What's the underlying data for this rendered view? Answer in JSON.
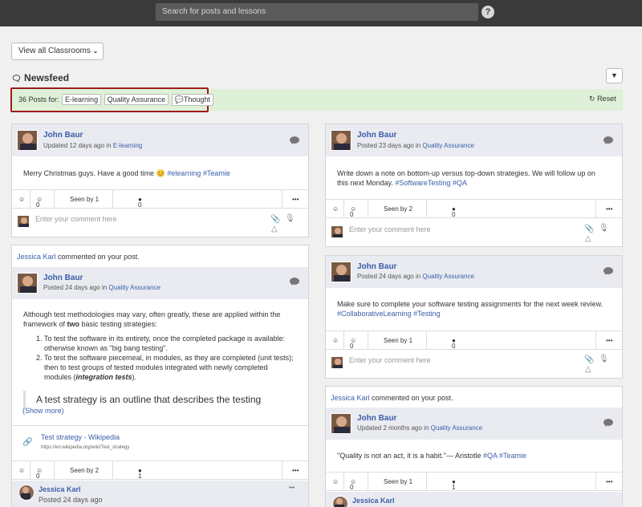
{
  "topbar": {
    "search_placeholder": "Search for posts and lessons",
    "help": "?"
  },
  "view_all": "View all Classrooms",
  "newsfeed_title": "Newsfeed",
  "filter": {
    "count_text": "36 Posts for:",
    "tags": [
      "E-learning",
      "Quality Assurance",
      "Thought"
    ],
    "reset": "Reset"
  },
  "common": {
    "comment_placeholder": "Enter your comment here",
    "likes": "0",
    "more": "•••",
    "commented_suffix": "commented on your post.",
    "in": "in"
  },
  "posts": [
    {
      "author": "John Baur",
      "time": "Updated 12 days ago",
      "category": "E-learning",
      "text": "Merry Christmas guys. Have a good time 😊 ",
      "hashtags": [
        "#elearning",
        "#Teamie"
      ],
      "seen": "Seen by 1",
      "comments": "0"
    },
    {
      "commenter": "Jessica Karl",
      "author": "John Baur",
      "time": "Posted 24 days ago",
      "category": "Quality Assurance",
      "intro_a": "Although test methodologies may vary, often greatly, these are applied within the",
      "intro_b": "framework of ",
      "intro_bold": "two",
      "intro_c": " basic testing strategies:",
      "li1_a": "To test the software in its entirety, once the completed package is available:",
      "li1_b": "otherwise known as \"big bang testing\".",
      "li2_a": "To test the ",
      "li2_link": "software piecemeal",
      "li2_b": ", in modules, as they are completed (unit tests);",
      "li2_c": "then to test groups of tested modules integrated with newly completed",
      "li2_d": "modules (",
      "li2_em": "integration tests",
      "li2_e": ").",
      "quote": "A test strategy is an outline that describes the testing",
      "show_more": "(Show more)",
      "link_title": "Test strategy - Wikipedia",
      "link_url": "https://en.wikipedia.org/wiki/Test_strategy",
      "seen": "Seen by 2",
      "comments": "1",
      "reply_author": "Jessica Karl",
      "reply_time": "Posted 24 days ago"
    },
    {
      "author": "John Baur",
      "time": "Posted 23 days ago",
      "category": "Quality Assurance",
      "text_a": "Write down a note on bottom-up versus top-down strategies. We will follow up on",
      "text_b": "this next Monday. ",
      "hashtags": [
        "#SoftwareTesting",
        "#QA"
      ],
      "seen": "Seen by 2",
      "comments": "0"
    },
    {
      "author": "John Baur",
      "time": "Posted 24 days ago",
      "category": "Quality Assurance",
      "text_a": "Make sure to complete your software testing assignments for the next week review.",
      "hashtags": [
        "#CollaborativeLearning",
        "#Testing"
      ],
      "seen": "Seen by 1",
      "comments": "0"
    },
    {
      "commenter": "Jessica Karl",
      "author": "John Baur",
      "time": "Updated 2 months ago",
      "category": "Quality Assurance",
      "text": "\"Quality is not an act, it is a habit.\"— Aristotle ",
      "hashtags": [
        "#QA",
        "#Teamie"
      ],
      "seen": "Seen by 1",
      "comments": "1",
      "reply_author": "Jessica Karl"
    }
  ]
}
